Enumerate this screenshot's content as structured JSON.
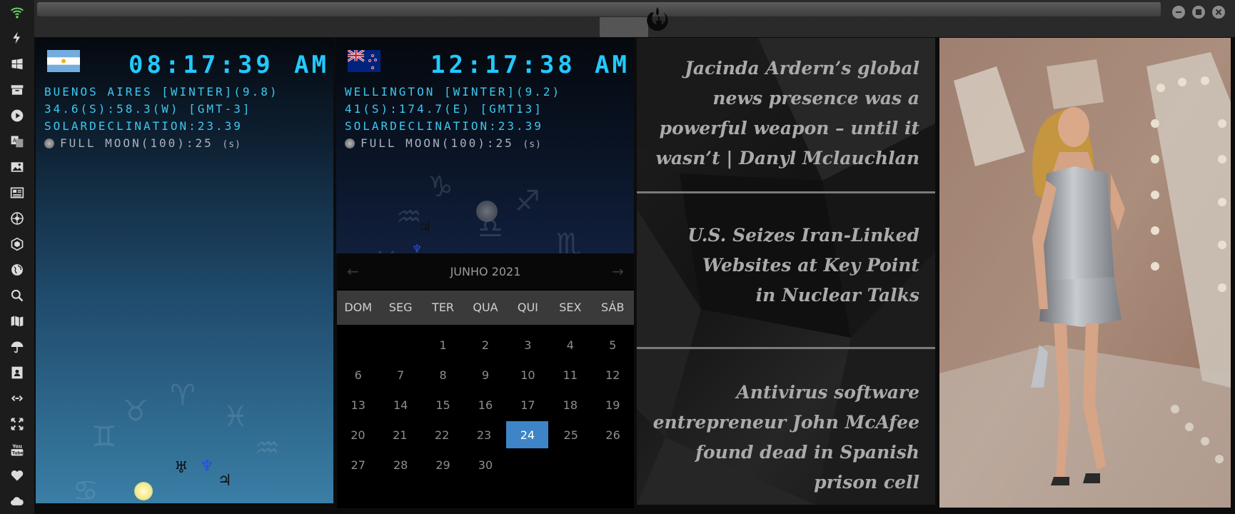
{
  "sidebar": {
    "icons": [
      "wifi-icon",
      "lightning-icon",
      "windows-icon",
      "archive-icon",
      "play-icon",
      "translate-icon",
      "image-icon",
      "news-icon",
      "galactic-icon",
      "hexagon-icon",
      "globe-icon",
      "search-icon",
      "map-icon",
      "umbrella-icon",
      "contact-card-icon",
      "link-icon",
      "fullscreen-icon",
      "youtube-icon",
      "heart-icon",
      "cloud-icon"
    ]
  },
  "clocks": [
    {
      "time": "08:17:39",
      "ampm": "AM",
      "location_line": "BUENOS AIRES [WINTER](9.8)",
      "coords_line": "34.6(S):58.3(W) [GMT-3]",
      "solar_line": "SOLARDECLINATION:23.39",
      "moon_line": "FULL MOON(100):25",
      "moon_suffix": "(s)",
      "flag": "argentina-flag"
    },
    {
      "time": "12:17:38",
      "ampm": "AM",
      "location_line": "WELLINGTON [WINTER](9.2)",
      "coords_line": "41(S):174.7(E) [GMT13]",
      "solar_line": "SOLARDECLINATION:23.39",
      "moon_line": "FULL MOON(100):25",
      "moon_suffix": "(s)",
      "flag": "new-zealand-flag"
    }
  ],
  "calendar": {
    "title": "JUNHO 2021",
    "weekdays": [
      "DOM",
      "SEG",
      "TER",
      "QUA",
      "QUI",
      "SEX",
      "SÁB"
    ],
    "weeks": [
      [
        "",
        "",
        "1",
        "2",
        "3",
        "4",
        "5"
      ],
      [
        "6",
        "7",
        "8",
        "9",
        "10",
        "11",
        "12"
      ],
      [
        "13",
        "14",
        "15",
        "16",
        "17",
        "18",
        "19"
      ],
      [
        "20",
        "21",
        "22",
        "23",
        "24",
        "25",
        "26"
      ],
      [
        "27",
        "28",
        "29",
        "30",
        "",
        "",
        ""
      ]
    ],
    "today": "24",
    "prev_icon": "←",
    "next_icon": "→"
  },
  "news": {
    "headlines": [
      "Jacinda Ardern’s global news presence was a powerful weapon – until it wasn’t | Danyl Mclauchlan",
      "U.S. Seizes Iran-Linked Websites at Key Point in Nuclear Talks",
      "Antivirus software entrepreneur John McAfee found dead in Spanish prison cell"
    ]
  },
  "colors": {
    "accent": "#22c9ff",
    "calendar_today": "#3d85c6",
    "wifi": "#6bd96b"
  }
}
